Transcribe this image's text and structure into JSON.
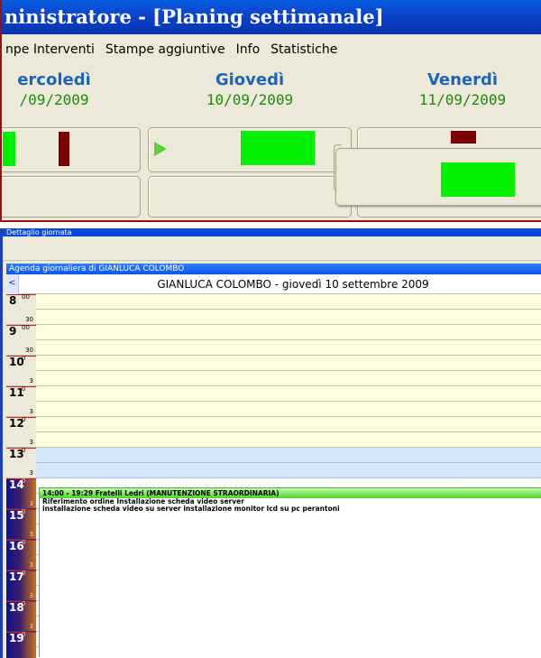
{
  "window": {
    "title": "ninistratore - [Planing settimanale]"
  },
  "menu": [
    "npe Interventi",
    "Stampe aggiuntive",
    "Info",
    "Statistiche"
  ],
  "days": [
    {
      "name": "ercoledì",
      "date": "/09/2009"
    },
    {
      "name": "Giovedì",
      "date": "10/09/2009"
    },
    {
      "name": "Venerdì",
      "date": "11/09/2009"
    }
  ],
  "colors": {
    "available": "#00f000",
    "busy": "#7a0000",
    "arrow": "#5cd13c"
  },
  "detail_window": {
    "title": "Dettaglio giornata"
  },
  "agenda": {
    "title": "Agenda giornaliera di GIANLUCA COLOMBO",
    "prev_label": "<",
    "date_label": "GIANLUCA COLOMBO - giovedì 10 settembre 2009",
    "hours": [
      {
        "hour": "8",
        "sup": "00",
        "half": "30"
      },
      {
        "hour": "9",
        "sup": "00",
        "half": "30"
      },
      {
        "hour": "10",
        "sup": "0",
        "half": "3"
      },
      {
        "hour": "11",
        "sup": "0",
        "half": "3"
      },
      {
        "hour": "12",
        "sup": "0",
        "half": "3"
      },
      {
        "hour": "13",
        "sup": "0",
        "half": "3"
      },
      {
        "hour": "14",
        "sup": "0",
        "half": "3"
      },
      {
        "hour": "15",
        "sup": "0",
        "half": "3"
      },
      {
        "hour": "16",
        "sup": "0",
        "half": "3"
      },
      {
        "hour": "17",
        "sup": "0",
        "half": "3"
      },
      {
        "hour": "18",
        "sup": "0",
        "half": "3"
      },
      {
        "hour": "19",
        "sup": "0",
        "half": ""
      }
    ],
    "appointment": {
      "header": "14:00 - 19:29 Fratelli Ledri (MANUTENZIONE STRAORDINARIA)",
      "line1": "Riferimento ordine Installazione scheda video server",
      "line2": "installazione scheda video su server  installazione monitor lcd su pc perantoni"
    }
  }
}
